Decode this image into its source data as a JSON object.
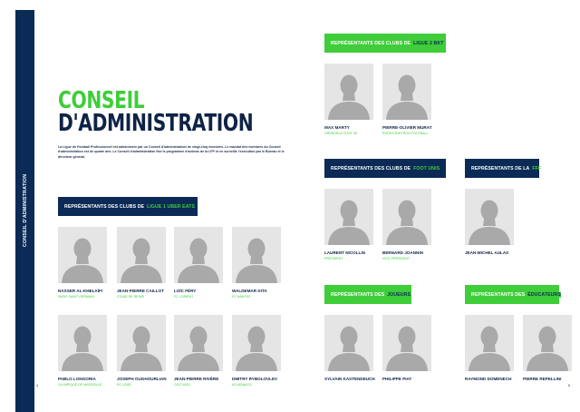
{
  "spine": {
    "label": "CONSEIL D'ADMINISTRATION"
  },
  "title": {
    "line1": "CONSEIL",
    "line2": "D'ADMINISTRATION"
  },
  "intro": "La Ligue de Football Professionnel est administrée par un Conseil d'administration de vingt-cinq membres. Le mandat des membres du Conseil d'administration est de quatre ans. Le Conseil d'administration fixe le programme d'actions de la LFP et en surveille l'exécution par le Bureau et le directeur général.",
  "sections": {
    "ligue1": {
      "prefix": "REPRÉSENTANTS DES CLUBS DE",
      "highlight": "LIGUE 1 UBER EATS"
    },
    "ligue2": {
      "prefix": "REPRÉSENTANTS DES CLUBS DE",
      "highlight": "LIGUE 2 BKT"
    },
    "footunis": {
      "prefix": "REPRÉSENTANTS DES CLUBS DE",
      "highlight": "FOOT UNIS"
    },
    "fff": {
      "prefix": "REPRÉSENTANTS DE LA",
      "highlight": "FFF"
    },
    "joueurs": {
      "prefix": "REPRÉSENTANTS DES",
      "highlight": "JOUEURS"
    },
    "educateurs": {
      "prefix": "REPRÉSENTANTS DES",
      "highlight": "ÉDUCATEURS"
    }
  },
  "people": {
    "p1": {
      "name": "NASSER AL-KHELAÏFI",
      "club": "PARIS SAINT-GERMAIN"
    },
    "p2": {
      "name": "JEAN-PIERRE CAILLOT",
      "club": "STADE DE REIMS"
    },
    "p3": {
      "name": "LOÏC FÉRY",
      "club": "FC LORIENT"
    },
    "p4": {
      "name": "WALDEMAR KITA",
      "club": "FC NANTES"
    },
    "p5": {
      "name": "PABLO LONGORIA",
      "club": "OLYMPIQUE DE MARSEILLE"
    },
    "p6": {
      "name": "JOSEPH OUGHOURLIAN",
      "club": "RC LENS"
    },
    "p7": {
      "name": "JEAN-PIERRE RIVÈRE",
      "club": "OGC NICE"
    },
    "p8": {
      "name": "DMITRY RYBOLOVLEV",
      "club": "AS MONACO"
    },
    "p9": {
      "name": "MAX MARTY",
      "club": "GRENOBLE FOOT 38"
    },
    "p10": {
      "name": "PIERRE-OLIVIER MURAT",
      "club": "RODEZ AVEYRON FOOTBALL"
    },
    "p11": {
      "name": "LAURENT NICOLLIN",
      "club": "PRÉSIDENT"
    },
    "p12": {
      "name": "BERNARD JOANNIN",
      "club": "VICE-PRÉSIDENT"
    },
    "p13": {
      "name": "JEAN-MICHEL AULAS",
      "club": ""
    },
    "p14": {
      "name": "SYLVAIN KASTENDEUCH",
      "club": ""
    },
    "p15": {
      "name": "PHILIPPE PIAT",
      "club": ""
    },
    "p16": {
      "name": "RAYMOND DOMENECH",
      "club": ""
    },
    "p17": {
      "name": "PIERRE REPELLINI",
      "club": ""
    }
  },
  "pages": {
    "left": "4",
    "right": "5"
  }
}
